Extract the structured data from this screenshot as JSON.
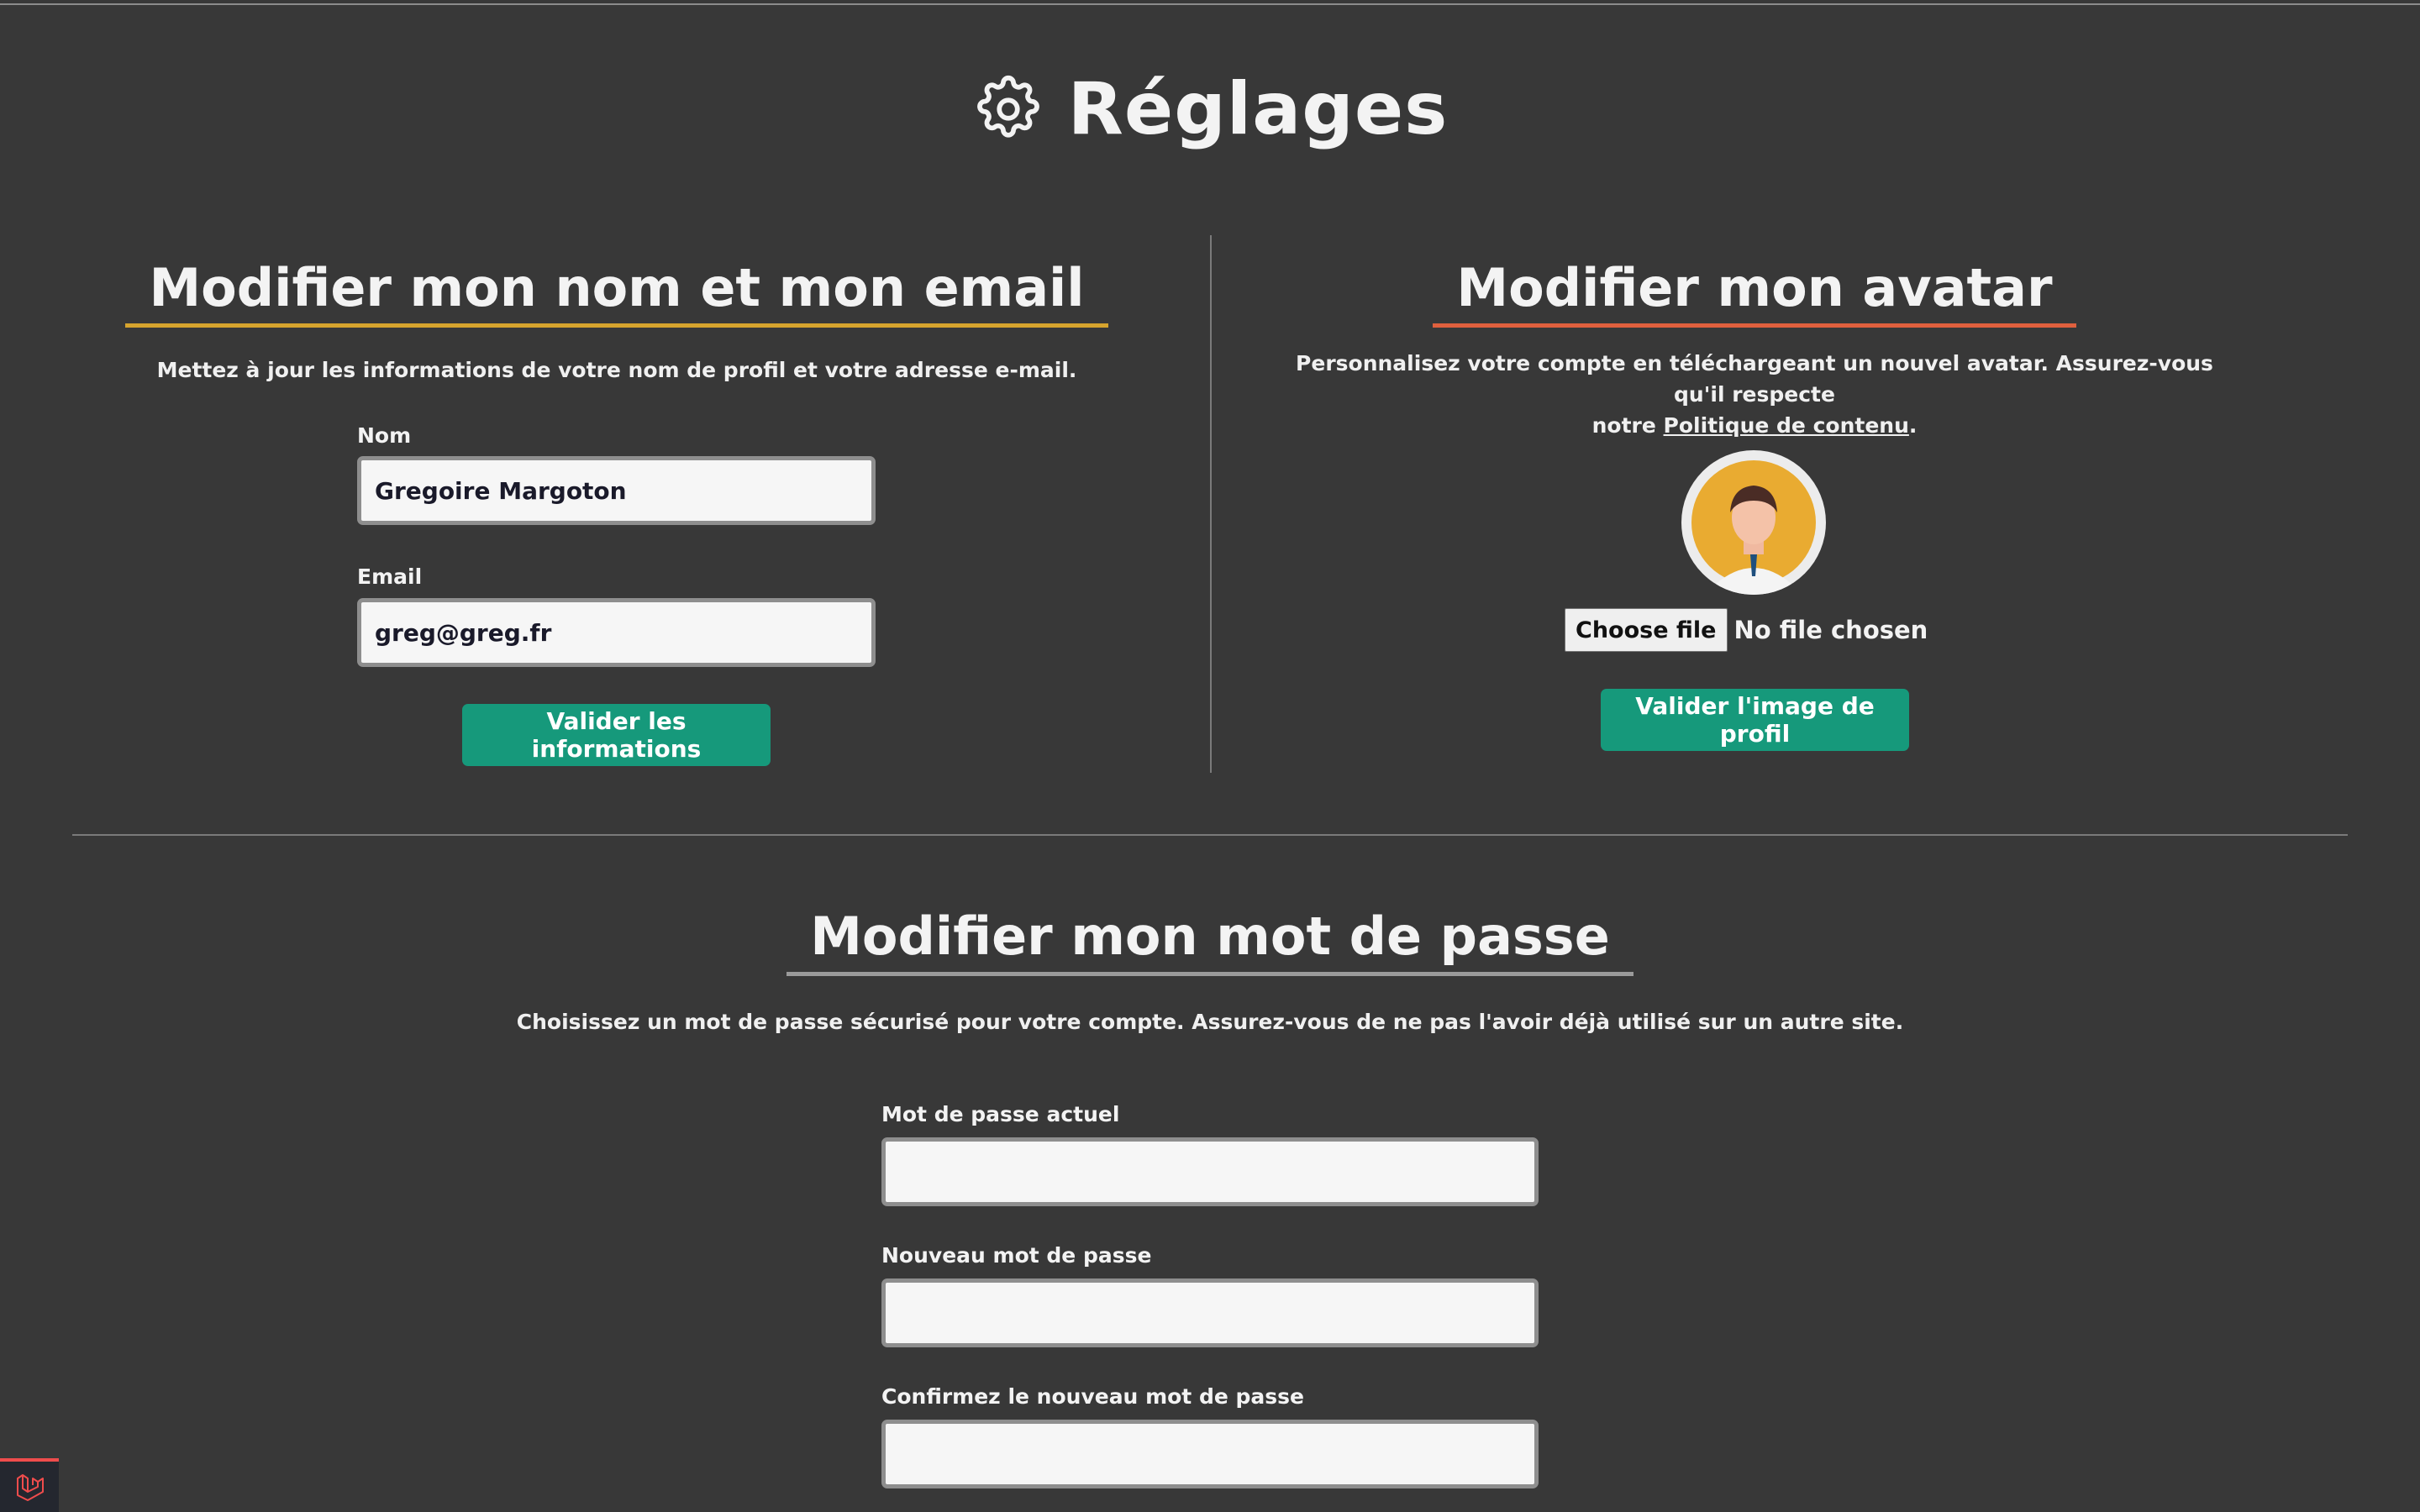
{
  "header": {
    "title": "Réglages",
    "icon": "gear-icon"
  },
  "profile_section": {
    "title": "Modifier mon nom et mon email",
    "underline_color": "#d6a42e",
    "description": "Mettez à jour les informations de votre nom de profil et votre adresse e-mail.",
    "name_label": "Nom",
    "name_value": "Gregoire Margoton",
    "email_label": "Email",
    "email_value": "greg@greg.fr",
    "submit_label": "Valider les informations"
  },
  "avatar_section": {
    "title": "Modifier mon avatar",
    "underline_color": "#e0603e",
    "description_line1": "Personnalisez votre compte en téléchargeant un nouvel avatar. Assurez-vous qu'il respecte",
    "description_line2_prefix": "notre ",
    "policy_link": "Politique de contenu",
    "description_line2_suffix": ".",
    "file_button": "Choose file",
    "file_status": "No file chosen",
    "submit_label": "Valider l'image de profil"
  },
  "password_section": {
    "title": "Modifier mon mot de passe",
    "underline_color": "#9a9a9a",
    "description": "Choisissez un mot de passe sécurisé pour votre compte. Assurez-vous de ne pas l'avoir déjà utilisé sur un autre site.",
    "current_label": "Mot de passe actuel",
    "current_value": "",
    "new_label": "Nouveau mot de passe",
    "new_value": "",
    "confirm_label": "Confirmez le nouveau mot de passe",
    "confirm_value": ""
  },
  "colors": {
    "background": "#383838",
    "accent_button": "#16997b"
  },
  "debug_badge": {
    "icon": "laravel-icon"
  }
}
